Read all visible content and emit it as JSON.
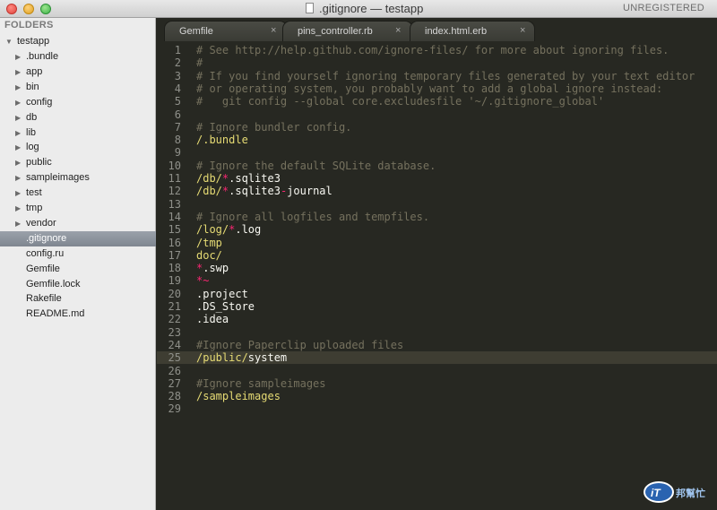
{
  "window": {
    "title": ".gitignore — testapp",
    "license_status": "UNREGISTERED"
  },
  "sidebar": {
    "header": "FOLDERS",
    "root": "testapp",
    "folders": [
      "bundle_placeholder"
    ],
    "items": [
      {
        "label": ".bundle",
        "type": "folder"
      },
      {
        "label": "app",
        "type": "folder"
      },
      {
        "label": "bin",
        "type": "folder"
      },
      {
        "label": "config",
        "type": "folder"
      },
      {
        "label": "db",
        "type": "folder"
      },
      {
        "label": "lib",
        "type": "folder"
      },
      {
        "label": "log",
        "type": "folder"
      },
      {
        "label": "public",
        "type": "folder"
      },
      {
        "label": "sampleimages",
        "type": "folder"
      },
      {
        "label": "test",
        "type": "folder"
      },
      {
        "label": "tmp",
        "type": "folder"
      },
      {
        "label": "vendor",
        "type": "folder"
      },
      {
        "label": ".gitignore",
        "type": "file",
        "selected": true
      },
      {
        "label": "config.ru",
        "type": "file"
      },
      {
        "label": "Gemfile",
        "type": "file"
      },
      {
        "label": "Gemfile.lock",
        "type": "file"
      },
      {
        "label": "Rakefile",
        "type": "file"
      },
      {
        "label": "README.md",
        "type": "file"
      }
    ]
  },
  "tabs": [
    {
      "label": "Gemfile",
      "active": false,
      "close": "×"
    },
    {
      "label": "pins_controller.rb",
      "active": false,
      "close": "×"
    },
    {
      "label": "index.html.erb",
      "active": false,
      "close": "×"
    }
  ],
  "editor": {
    "highlighted_line": 25,
    "lines": [
      [
        {
          "t": "# See http://help.github.com/ignore-files/ for more about ignoring files.",
          "c": "comment"
        }
      ],
      [
        {
          "t": "#",
          "c": "comment"
        }
      ],
      [
        {
          "t": "# If you find yourself ignoring temporary files generated by your text editor",
          "c": "comment"
        }
      ],
      [
        {
          "t": "# or operating system, you probably want to add a global ignore instead:",
          "c": "comment"
        }
      ],
      [
        {
          "t": "#   git config --global core.excludesfile '~/.gitignore_global'",
          "c": "comment"
        }
      ],
      [],
      [
        {
          "t": "# Ignore bundler config.",
          "c": "comment"
        }
      ],
      [
        {
          "t": "/.bundle",
          "c": "yellow"
        }
      ],
      [],
      [
        {
          "t": "# Ignore the default SQLite database.",
          "c": "comment"
        }
      ],
      [
        {
          "t": "/db/",
          "c": "yellow"
        },
        {
          "t": "*",
          "c": "pink"
        },
        {
          "t": ".sqlite3",
          "c": "white"
        }
      ],
      [
        {
          "t": "/db/",
          "c": "yellow"
        },
        {
          "t": "*",
          "c": "pink"
        },
        {
          "t": ".sqlite3",
          "c": "white"
        },
        {
          "t": "-",
          "c": "pink"
        },
        {
          "t": "journal",
          "c": "white"
        }
      ],
      [],
      [
        {
          "t": "# Ignore all logfiles and tempfiles.",
          "c": "comment"
        }
      ],
      [
        {
          "t": "/log/",
          "c": "yellow"
        },
        {
          "t": "*",
          "c": "pink"
        },
        {
          "t": ".log",
          "c": "white"
        }
      ],
      [
        {
          "t": "/tmp",
          "c": "yellow"
        }
      ],
      [
        {
          "t": "doc/",
          "c": "yellow"
        }
      ],
      [
        {
          "t": "*",
          "c": "pink"
        },
        {
          "t": ".swp",
          "c": "white"
        }
      ],
      [
        {
          "t": "*~",
          "c": "pink"
        }
      ],
      [
        {
          "t": ".project",
          "c": "white"
        }
      ],
      [
        {
          "t": ".DS_Store",
          "c": "white"
        }
      ],
      [
        {
          "t": ".idea",
          "c": "white"
        }
      ],
      [],
      [
        {
          "t": "#Ignore Paperclip uploaded files",
          "c": "comment"
        }
      ],
      [
        {
          "t": "/public/",
          "c": "yellow"
        },
        {
          "t": "system",
          "c": "white"
        }
      ],
      [],
      [
        {
          "t": "#Ignore sampleimages",
          "c": "comment"
        }
      ],
      [
        {
          "t": "/sampleimages",
          "c": "yellow"
        }
      ],
      []
    ]
  },
  "watermark": {
    "badge": "iT",
    "text": "邦幫忙"
  },
  "icons": {
    "expanded": "triangle-down-icon",
    "collapsed": "triangle-right-icon",
    "close": "close-icon"
  }
}
